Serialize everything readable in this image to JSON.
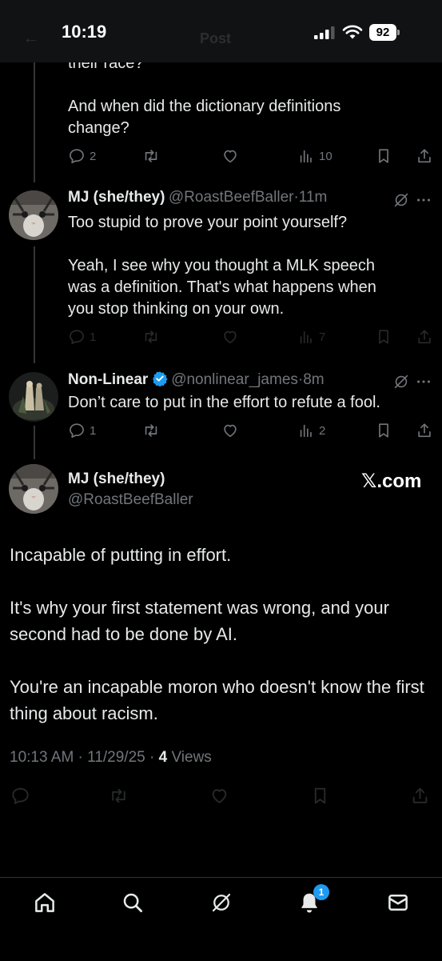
{
  "status_bar": {
    "time": "10:19",
    "battery": "92",
    "header_title": "Post"
  },
  "thread": [
    {
      "partial_text": "their race?\n\nAnd when did the dictionary definitions\nchange?",
      "actions": {
        "replies": "2",
        "views": "10"
      }
    },
    {
      "name": "MJ (she/they)",
      "handle": "@RoastBeefBaller",
      "time": "11m",
      "text": "Too stupid to prove your point yourself?\n\nYeah, I see why you thought a MLK speech\nwas a definition. That's what happens when\nyou stop thinking on your own.",
      "actions": {
        "replies": "1",
        "views": "7"
      }
    },
    {
      "name": "Non-Linear",
      "handle": "@nonlinear_james",
      "time": "8m",
      "text": "Don’t care to put in the effort to refute a fool.",
      "actions": {
        "replies": "1",
        "views": "2"
      }
    }
  ],
  "main_post": {
    "name": "MJ (she/they)",
    "handle": "@RoastBeefBaller",
    "watermark": "𝕏.com",
    "paragraphs": [
      "Incapable of putting in effort.",
      "It's why your first statement was wrong, and your second had to be done by AI.",
      "You're an incapable moron who doesn't know the first thing about racism."
    ],
    "timestamp": "10:13 AM · 11/29/25 · ",
    "views_count": "4",
    "views_label": " Views"
  },
  "tabbar": {
    "notification_badge": "1"
  },
  "colors": {
    "accent": "#1d9bf0",
    "muted": "#71767b",
    "text": "#e7e9ea",
    "background": "#000000"
  },
  "icons": [
    "reply-icon",
    "retweet-icon",
    "like-icon",
    "views-icon",
    "bookmark-icon",
    "share-icon",
    "grok-icon",
    "more-icon",
    "verified-badge-icon",
    "home-icon",
    "search-icon",
    "notifications-icon",
    "messages-icon"
  ]
}
